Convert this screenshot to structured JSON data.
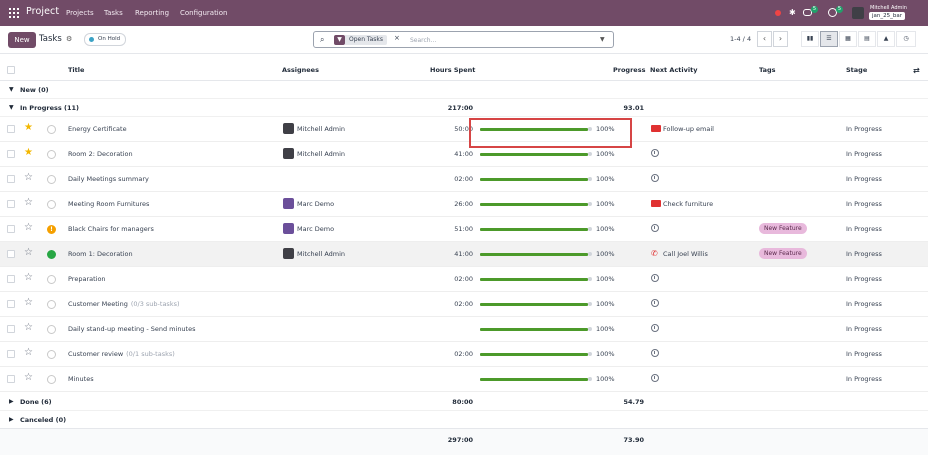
{
  "topbar": {
    "app": "Project",
    "menu": [
      "Projects",
      "Tasks",
      "Reporting",
      "Configuration"
    ],
    "messages_badge": "5",
    "activities_badge": "5",
    "user_name": "Mitchell Admin",
    "db_name": "jan_25_bar"
  },
  "control": {
    "new_label": "New",
    "breadcrumb": "Tasks",
    "on_hold": "On Hold",
    "facet": "Open Tasks",
    "search_placeholder": "Search...",
    "pager": "1-4 / 4",
    "views": [
      "kanban-view",
      "list-view",
      "calendar-view",
      "pivot-view",
      "graph-view",
      "activity-view"
    ],
    "active_view": "list-view"
  },
  "columns": {
    "title": "Title",
    "assignees": "Assignees",
    "hours": "Hours Spent",
    "progress": "Progress",
    "activity": "Next Activity",
    "tags": "Tags",
    "stage": "Stage"
  },
  "groups": {
    "new": {
      "label": "New (0)",
      "hours": "",
      "progress": ""
    },
    "in_progress": {
      "label": "In Progress (11)",
      "hours": "217:00",
      "progress": "93.01"
    },
    "done": {
      "label": "Done (6)",
      "hours": "80:00",
      "progress": "54.79"
    },
    "canceled": {
      "label": "Canceled (0)",
      "hours": "",
      "progress": ""
    }
  },
  "rows": [
    {
      "title": "Energy Certificate",
      "sub": "",
      "starred": true,
      "priority": "none",
      "assignee": "Mitchell Admin",
      "avatar": "mitchell",
      "hours": "50:00",
      "progress": 1.0,
      "progress_label": "100%",
      "activity_icon": "email-icon",
      "activity": "Follow-up email",
      "tag": "",
      "stage": "In Progress"
    },
    {
      "title": "Room 2: Decoration",
      "sub": "",
      "starred": true,
      "priority": "none",
      "assignee": "Mitchell Admin",
      "avatar": "mitchell",
      "hours": "41:00",
      "progress": 1.0,
      "progress_label": "100%",
      "activity_icon": "clock-icon",
      "activity": "",
      "tag": "",
      "stage": "In Progress"
    },
    {
      "title": "Daily Meetings summary",
      "sub": "",
      "starred": false,
      "priority": "none",
      "assignee": "",
      "avatar": "",
      "hours": "02:00",
      "progress": 1.0,
      "progress_label": "100%",
      "activity_icon": "clock-icon",
      "activity": "",
      "tag": "",
      "stage": "In Progress"
    },
    {
      "title": "Meeting Room Furnitures",
      "sub": "",
      "starred": false,
      "priority": "none",
      "assignee": "Marc Demo",
      "avatar": "marc",
      "hours": "26:00",
      "progress": 1.0,
      "progress_label": "100%",
      "activity_icon": "todo-icon",
      "activity": "Check furniture",
      "tag": "",
      "stage": "In Progress"
    },
    {
      "title": "Black Chairs for managers",
      "sub": "",
      "starred": false,
      "priority": "orange",
      "assignee": "Marc Demo",
      "avatar": "marc",
      "hours": "51:00",
      "progress": 1.0,
      "progress_label": "100%",
      "activity_icon": "clock-icon",
      "activity": "",
      "tag": "New Feature",
      "stage": "In Progress"
    },
    {
      "title": "Room 1: Decoration",
      "sub": "",
      "starred": false,
      "priority": "green",
      "assignee": "Mitchell Admin",
      "avatar": "mitchell",
      "hours": "41:00",
      "progress": 1.0,
      "progress_label": "100%",
      "activity_icon": "phone-icon",
      "activity": "Call Joel Willis",
      "tag": "New Feature",
      "stage": "In Progress"
    },
    {
      "title": "Preparation",
      "sub": "",
      "starred": false,
      "priority": "none",
      "assignee": "",
      "avatar": "",
      "hours": "02:00",
      "progress": 1.0,
      "progress_label": "100%",
      "activity_icon": "clock-icon",
      "activity": "",
      "tag": "",
      "stage": "In Progress"
    },
    {
      "title": "Customer Meeting",
      "sub": "(0/3 sub-tasks)",
      "starred": false,
      "priority": "none",
      "assignee": "",
      "avatar": "",
      "hours": "02:00",
      "progress": 1.0,
      "progress_label": "100%",
      "activity_icon": "clock-icon",
      "activity": "",
      "tag": "",
      "stage": "In Progress"
    },
    {
      "title": "Daily stand-up meeting - Send minutes",
      "sub": "",
      "starred": false,
      "priority": "none",
      "assignee": "",
      "avatar": "",
      "hours": "",
      "progress": 1.0,
      "progress_label": "100%",
      "activity_icon": "clock-icon",
      "activity": "",
      "tag": "",
      "stage": "In Progress"
    },
    {
      "title": "Customer review",
      "sub": "(0/1 sub-tasks)",
      "starred": false,
      "priority": "none",
      "assignee": "",
      "avatar": "",
      "hours": "02:00",
      "progress": 1.0,
      "progress_label": "100%",
      "activity_icon": "clock-icon",
      "activity": "",
      "tag": "",
      "stage": "In Progress"
    },
    {
      "title": "Minutes",
      "sub": "",
      "starred": false,
      "priority": "none",
      "assignee": "",
      "avatar": "",
      "hours": "",
      "progress": 1.0,
      "progress_label": "100%",
      "activity_icon": "clock-icon",
      "activity": "",
      "tag": "",
      "stage": "In Progress"
    }
  ],
  "totals": {
    "hours": "297:00",
    "progress": "73.90"
  },
  "colors": {
    "brand": "#714b67",
    "progress": "#4c9a2a",
    "tag": "#e8b9dc",
    "highlight": "#d64545"
  }
}
